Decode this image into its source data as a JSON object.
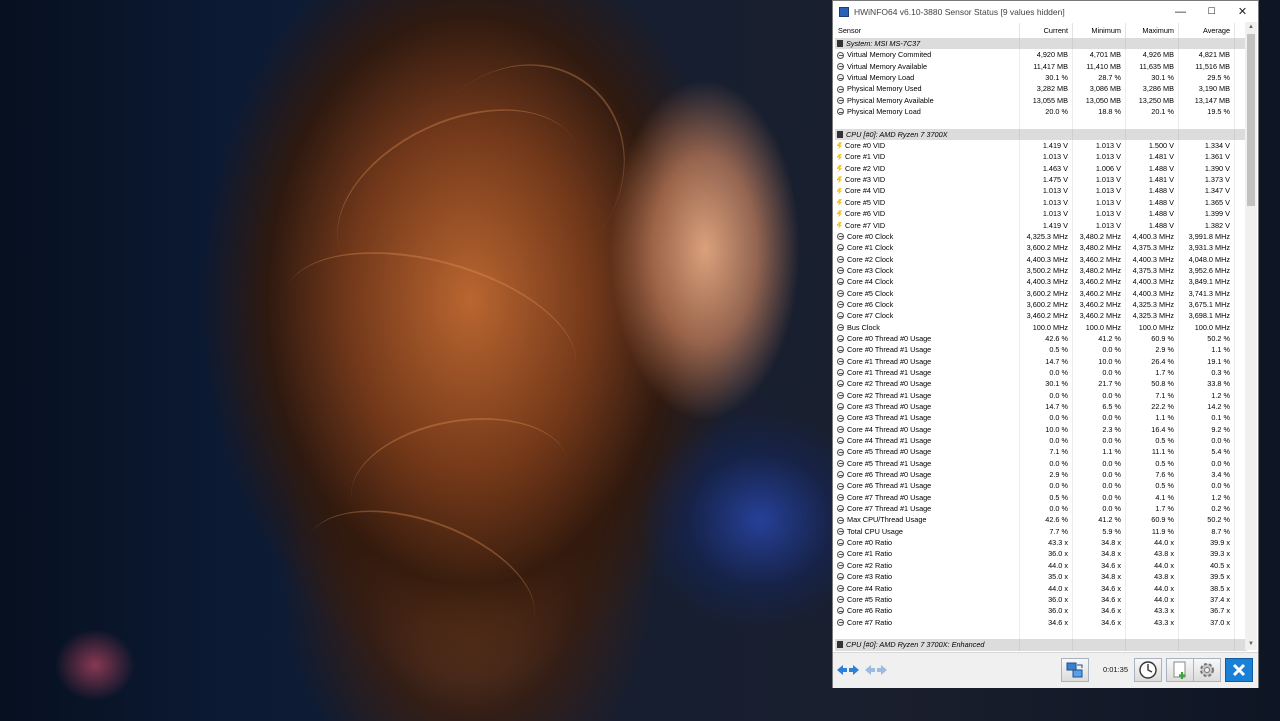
{
  "window": {
    "title": "HWiNFO64 v6.10-3880 Sensor Status [9 values hidden]",
    "controls": {
      "minimize": "—",
      "maximize": "☐",
      "close": "✕"
    }
  },
  "columns": {
    "sensor": "Sensor",
    "current": "Current",
    "minimum": "Minimum",
    "maximum": "Maximum",
    "average": "Average"
  },
  "rows": [
    {
      "type": "group",
      "label": "System: MSI MS-7C37"
    },
    {
      "type": "data",
      "icon": "clock",
      "label": "Virtual Memory Commited",
      "cur": "4,920 MB",
      "min": "4,701 MB",
      "max": "4,926 MB",
      "avg": "4,821 MB"
    },
    {
      "type": "data",
      "icon": "clock",
      "label": "Virtual Memory Available",
      "cur": "11,417 MB",
      "min": "11,410 MB",
      "max": "11,635 MB",
      "avg": "11,516 MB"
    },
    {
      "type": "data",
      "icon": "clock",
      "label": "Virtual Memory Load",
      "cur": "30.1 %",
      "min": "28.7 %",
      "max": "30.1 %",
      "avg": "29.5 %"
    },
    {
      "type": "data",
      "icon": "clock",
      "label": "Physical Memory Used",
      "cur": "3,282 MB",
      "min": "3,086 MB",
      "max": "3,286 MB",
      "avg": "3,190 MB"
    },
    {
      "type": "data",
      "icon": "clock",
      "label": "Physical Memory Available",
      "cur": "13,055 MB",
      "min": "13,050 MB",
      "max": "13,250 MB",
      "avg": "13,147 MB"
    },
    {
      "type": "data",
      "icon": "clock",
      "label": "Physical Memory Load",
      "cur": "20.0 %",
      "min": "18.8 %",
      "max": "20.1 %",
      "avg": "19.5 %"
    },
    {
      "type": "blank"
    },
    {
      "type": "group",
      "label": "CPU [#0]: AMD Ryzen 7 3700X"
    },
    {
      "type": "data",
      "icon": "volt",
      "label": "Core #0 VID",
      "cur": "1.419 V",
      "min": "1.013 V",
      "max": "1.500 V",
      "avg": "1.334 V"
    },
    {
      "type": "data",
      "icon": "volt",
      "label": "Core #1 VID",
      "cur": "1.013 V",
      "min": "1.013 V",
      "max": "1.481 V",
      "avg": "1.361 V"
    },
    {
      "type": "data",
      "icon": "volt",
      "label": "Core #2 VID",
      "cur": "1.463 V",
      "min": "1.006 V",
      "max": "1.488 V",
      "avg": "1.390 V"
    },
    {
      "type": "data",
      "icon": "volt",
      "label": "Core #3 VID",
      "cur": "1.475 V",
      "min": "1.013 V",
      "max": "1.481 V",
      "avg": "1.373 V"
    },
    {
      "type": "data",
      "icon": "volt",
      "label": "Core #4 VID",
      "cur": "1.013 V",
      "min": "1.013 V",
      "max": "1.488 V",
      "avg": "1.347 V"
    },
    {
      "type": "data",
      "icon": "volt",
      "label": "Core #5 VID",
      "cur": "1.013 V",
      "min": "1.013 V",
      "max": "1.488 V",
      "avg": "1.365 V"
    },
    {
      "type": "data",
      "icon": "volt",
      "label": "Core #6 VID",
      "cur": "1.013 V",
      "min": "1.013 V",
      "max": "1.488 V",
      "avg": "1.399 V"
    },
    {
      "type": "data",
      "icon": "volt",
      "label": "Core #7 VID",
      "cur": "1.419 V",
      "min": "1.013 V",
      "max": "1.488 V",
      "avg": "1.382 V"
    },
    {
      "type": "data",
      "icon": "clock",
      "label": "Core #0 Clock",
      "cur": "4,325.3 MHz",
      "min": "3,480.2 MHz",
      "max": "4,400.3 MHz",
      "avg": "3,991.8 MHz"
    },
    {
      "type": "data",
      "icon": "clock",
      "label": "Core #1 Clock",
      "cur": "3,600.2 MHz",
      "min": "3,480.2 MHz",
      "max": "4,375.3 MHz",
      "avg": "3,931.3 MHz"
    },
    {
      "type": "data",
      "icon": "clock",
      "label": "Core #2 Clock",
      "cur": "4,400.3 MHz",
      "min": "3,460.2 MHz",
      "max": "4,400.3 MHz",
      "avg": "4,048.0 MHz"
    },
    {
      "type": "data",
      "icon": "clock",
      "label": "Core #3 Clock",
      "cur": "3,500.2 MHz",
      "min": "3,480.2 MHz",
      "max": "4,375.3 MHz",
      "avg": "3,952.6 MHz"
    },
    {
      "type": "data",
      "icon": "clock",
      "label": "Core #4 Clock",
      "cur": "4,400.3 MHz",
      "min": "3,460.2 MHz",
      "max": "4,400.3 MHz",
      "avg": "3,849.1 MHz"
    },
    {
      "type": "data",
      "icon": "clock",
      "label": "Core #5 Clock",
      "cur": "3,600.2 MHz",
      "min": "3,460.2 MHz",
      "max": "4,400.3 MHz",
      "avg": "3,741.3 MHz"
    },
    {
      "type": "data",
      "icon": "clock",
      "label": "Core #6 Clock",
      "cur": "3,600.2 MHz",
      "min": "3,460.2 MHz",
      "max": "4,325.3 MHz",
      "avg": "3,675.1 MHz"
    },
    {
      "type": "data",
      "icon": "clock",
      "label": "Core #7 Clock",
      "cur": "3,460.2 MHz",
      "min": "3,460.2 MHz",
      "max": "4,325.3 MHz",
      "avg": "3,698.1 MHz"
    },
    {
      "type": "data",
      "icon": "clock",
      "label": "Bus Clock",
      "cur": "100.0 MHz",
      "min": "100.0 MHz",
      "max": "100.0 MHz",
      "avg": "100.0 MHz"
    },
    {
      "type": "data",
      "icon": "clock",
      "label": "Core #0 Thread #0 Usage",
      "cur": "42.6 %",
      "min": "41.2 %",
      "max": "60.9 %",
      "avg": "50.2 %"
    },
    {
      "type": "data",
      "icon": "clock",
      "label": "Core #0 Thread #1 Usage",
      "cur": "0.5 %",
      "min": "0.0 %",
      "max": "2.9 %",
      "avg": "1.1 %"
    },
    {
      "type": "data",
      "icon": "clock",
      "label": "Core #1 Thread #0 Usage",
      "cur": "14.7 %",
      "min": "10.0 %",
      "max": "26.4 %",
      "avg": "19.1 %"
    },
    {
      "type": "data",
      "icon": "clock",
      "label": "Core #1 Thread #1 Usage",
      "cur": "0.0 %",
      "min": "0.0 %",
      "max": "1.7 %",
      "avg": "0.3 %"
    },
    {
      "type": "data",
      "icon": "clock",
      "label": "Core #2 Thread #0 Usage",
      "cur": "30.1 %",
      "min": "21.7 %",
      "max": "50.8 %",
      "avg": "33.8 %"
    },
    {
      "type": "data",
      "icon": "clock",
      "label": "Core #2 Thread #1 Usage",
      "cur": "0.0 %",
      "min": "0.0 %",
      "max": "7.1 %",
      "avg": "1.2 %"
    },
    {
      "type": "data",
      "icon": "clock",
      "label": "Core #3 Thread #0 Usage",
      "cur": "14.7 %",
      "min": "6.5 %",
      "max": "22.2 %",
      "avg": "14.2 %"
    },
    {
      "type": "data",
      "icon": "clock",
      "label": "Core #3 Thread #1 Usage",
      "cur": "0.0 %",
      "min": "0.0 %",
      "max": "1.1 %",
      "avg": "0.1 %"
    },
    {
      "type": "data",
      "icon": "clock",
      "label": "Core #4 Thread #0 Usage",
      "cur": "10.0 %",
      "min": "2.3 %",
      "max": "16.4 %",
      "avg": "9.2 %"
    },
    {
      "type": "data",
      "icon": "clock",
      "label": "Core #4 Thread #1 Usage",
      "cur": "0.0 %",
      "min": "0.0 %",
      "max": "0.5 %",
      "avg": "0.0 %"
    },
    {
      "type": "data",
      "icon": "clock",
      "label": "Core #5 Thread #0 Usage",
      "cur": "7.1 %",
      "min": "1.1 %",
      "max": "11.1 %",
      "avg": "5.4 %"
    },
    {
      "type": "data",
      "icon": "clock",
      "label": "Core #5 Thread #1 Usage",
      "cur": "0.0 %",
      "min": "0.0 %",
      "max": "0.5 %",
      "avg": "0.0 %"
    },
    {
      "type": "data",
      "icon": "clock",
      "label": "Core #6 Thread #0 Usage",
      "cur": "2.9 %",
      "min": "0.0 %",
      "max": "7.6 %",
      "avg": "3.4 %"
    },
    {
      "type": "data",
      "icon": "clock",
      "label": "Core #6 Thread #1 Usage",
      "cur": "0.0 %",
      "min": "0.0 %",
      "max": "0.5 %",
      "avg": "0.0 %"
    },
    {
      "type": "data",
      "icon": "clock",
      "label": "Core #7 Thread #0 Usage",
      "cur": "0.5 %",
      "min": "0.0 %",
      "max": "4.1 %",
      "avg": "1.2 %"
    },
    {
      "type": "data",
      "icon": "clock",
      "label": "Core #7 Thread #1 Usage",
      "cur": "0.0 %",
      "min": "0.0 %",
      "max": "1.7 %",
      "avg": "0.2 %"
    },
    {
      "type": "data",
      "icon": "clock",
      "label": "Max CPU/Thread Usage",
      "cur": "42.6 %",
      "min": "41.2 %",
      "max": "60.9 %",
      "avg": "50.2 %"
    },
    {
      "type": "data",
      "icon": "clock",
      "label": "Total CPU Usage",
      "cur": "7.7 %",
      "min": "5.9 %",
      "max": "11.9 %",
      "avg": "8.7 %"
    },
    {
      "type": "data",
      "icon": "clock",
      "label": "Core #0 Ratio",
      "cur": "43.3 x",
      "min": "34.8 x",
      "max": "44.0 x",
      "avg": "39.9 x"
    },
    {
      "type": "data",
      "icon": "clock",
      "label": "Core #1 Ratio",
      "cur": "36.0 x",
      "min": "34.8 x",
      "max": "43.8 x",
      "avg": "39.3 x"
    },
    {
      "type": "data",
      "icon": "clock",
      "label": "Core #2 Ratio",
      "cur": "44.0 x",
      "min": "34.6 x",
      "max": "44.0 x",
      "avg": "40.5 x"
    },
    {
      "type": "data",
      "icon": "clock",
      "label": "Core #3 Ratio",
      "cur": "35.0 x",
      "min": "34.8 x",
      "max": "43.8 x",
      "avg": "39.5 x"
    },
    {
      "type": "data",
      "icon": "clock",
      "label": "Core #4 Ratio",
      "cur": "44.0 x",
      "min": "34.6 x",
      "max": "44.0 x",
      "avg": "38.5 x"
    },
    {
      "type": "data",
      "icon": "clock",
      "label": "Core #5 Ratio",
      "cur": "36.0 x",
      "min": "34.6 x",
      "max": "44.0 x",
      "avg": "37.4 x"
    },
    {
      "type": "data",
      "icon": "clock",
      "label": "Core #6 Ratio",
      "cur": "36.0 x",
      "min": "34.6 x",
      "max": "43.3 x",
      "avg": "36.7 x"
    },
    {
      "type": "data",
      "icon": "clock",
      "label": "Core #7 Ratio",
      "cur": "34.6 x",
      "min": "34.6 x",
      "max": "43.3 x",
      "avg": "37.0 x"
    },
    {
      "type": "blank"
    },
    {
      "type": "group",
      "label": "CPU [#0]: AMD Ryzen 7 3700X: Enhanced"
    }
  ],
  "toolbar": {
    "timer": "0:01:35",
    "icons": [
      "nav-arrows-icon",
      "nav-arrows-disabled-icon",
      "sensor-config-icon",
      "clock-icon",
      "add-report-icon",
      "settings-icon",
      "close-icon"
    ]
  },
  "colors": {
    "accent": "#2b62b8",
    "group_bg": "#dcdcdc",
    "close_button": "#1a7fd6"
  }
}
